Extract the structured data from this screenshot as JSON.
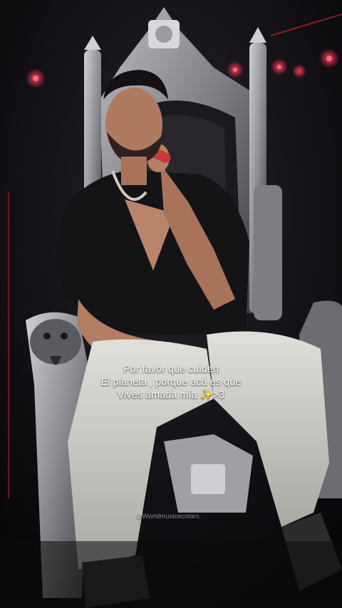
{
  "caption": {
    "line1": "Por favor que cuiden",
    "line2": "El planeta , porque acá es que",
    "line3": "Vives amada mía ✨>3"
  },
  "watermark": "@Worldmusicecstars"
}
